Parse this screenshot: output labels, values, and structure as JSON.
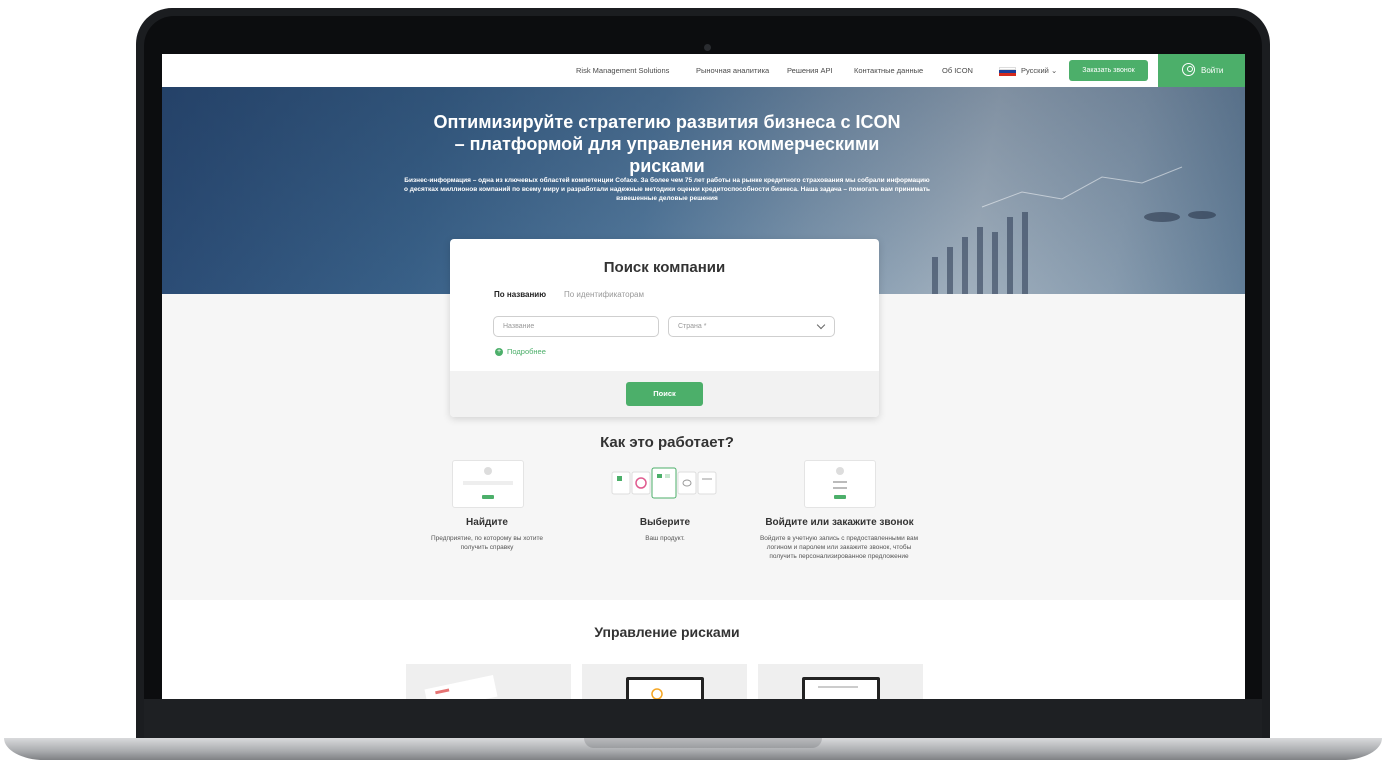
{
  "nav": {
    "items": [
      "Risk Management Solutions",
      "Рыночная аналитика",
      "Решения API",
      "Контактные данные",
      "Об ICON"
    ],
    "language": "Русский",
    "call_button": "Заказать звонок",
    "login": "Войти"
  },
  "hero": {
    "title": "Оптимизируйте стратегию развития бизнеса с ICON – платформой для управления коммерческими рисками",
    "subtitle": "Бизнес-информация – одна из ключевых областей компетенции Coface. За более чем 75 лет работы на рынке кредитного страхования мы собрали информацию о десятках миллионов компаний по всему миру и разработали надежные методики оценки кредитоспособности бизнеса. Наша задача – помогать вам принимать взвешенные деловые решения"
  },
  "search": {
    "title": "Поиск компании",
    "tab_by_name": "По названию",
    "tab_by_id": "По идентификаторам",
    "name_placeholder": "Название",
    "country_placeholder": "Страна *",
    "more_label": "Подробнее",
    "button": "Поиск"
  },
  "how": {
    "title": "Как это работает?",
    "steps": [
      {
        "title": "Найдите",
        "desc": "Предприятие, по которому вы хотите получить справку"
      },
      {
        "title": "Выберите",
        "desc": "Ваш продукт."
      },
      {
        "title": "Войдите или закажите звонок",
        "desc": "Войдите в учетную запись с предоставленными вам логином и паролем или закажите звонок, чтобы получить персонализированное предложение"
      }
    ]
  },
  "risk": {
    "title": "Управление рисками"
  },
  "colors": {
    "accent": "#4caf6a",
    "hero": "#3f6a93"
  }
}
